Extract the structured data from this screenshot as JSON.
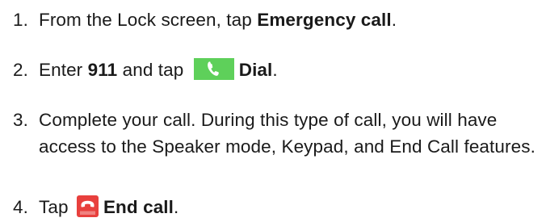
{
  "steps": [
    {
      "number": "1.",
      "text_before": "From the Lock screen, tap ",
      "bold": "Emergency call",
      "text_after": "."
    },
    {
      "number": "2.",
      "text_before": "Enter ",
      "bold_number": "911",
      "text_middle": " and tap ",
      "icon": "phone-dial-icon",
      "bold": "Dial",
      "text_after": "."
    },
    {
      "number": "3.",
      "text": "Complete your call. During this type of call, you will have access to the Speaker mode, Keypad, and End Call features."
    },
    {
      "number": "4.",
      "text_before": "Tap ",
      "icon": "end-call-icon",
      "bold": "End call",
      "text_after": "."
    }
  ],
  "colors": {
    "dial_icon_bg": "#5ed05a",
    "end_icon_bg": "#e8403d",
    "text": "#1a1a1a"
  }
}
